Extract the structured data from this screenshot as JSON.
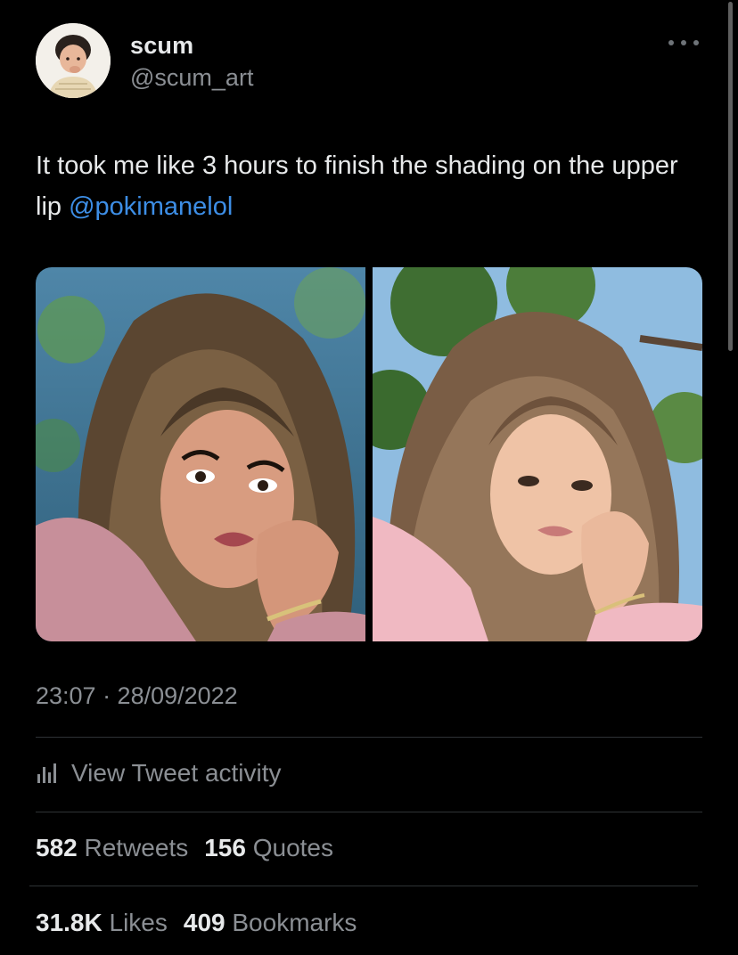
{
  "author": {
    "display_name": "scum",
    "handle": "@scum_art",
    "avatar_icon": "user-avatar"
  },
  "more_icon": "more-horizontal-icon",
  "tweet": {
    "text": "It took me like 3 hours to finish the shading on the upper lip ",
    "mention": "@pokimanelol"
  },
  "media": [
    {
      "kind": "digital-art-portrait"
    },
    {
      "kind": "reference-photo"
    }
  ],
  "timestamp": "23:07 · 28/09/2022",
  "activity": {
    "icon": "bar-chart-icon",
    "label": "View Tweet activity"
  },
  "stats": {
    "retweets_count": "582",
    "retweets_label": "Retweets",
    "quotes_count": "156",
    "quotes_label": "Quotes",
    "likes_count": "31.8K",
    "likes_label": "Likes",
    "bookmarks_count": "409",
    "bookmarks_label": "Bookmarks"
  },
  "colors": {
    "background": "#000000",
    "text_primary": "#e7e9ea",
    "text_secondary": "#8b8f94",
    "link": "#3d8ee6",
    "divider": "#2f3336"
  }
}
